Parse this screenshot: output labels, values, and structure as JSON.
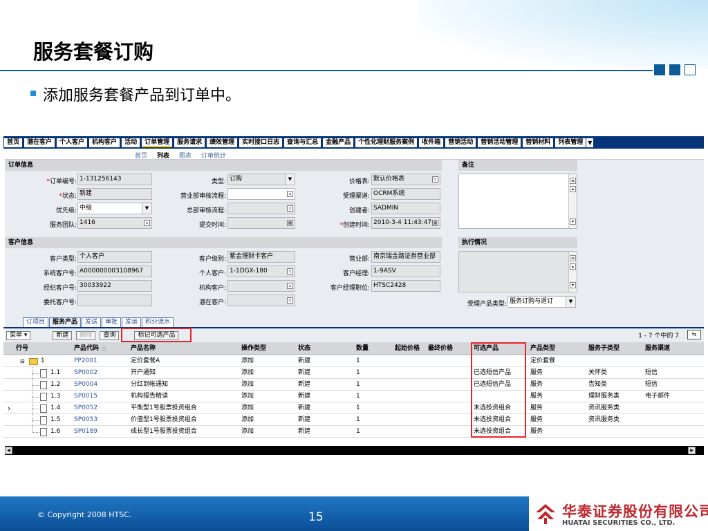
{
  "slide": {
    "title": "服务套餐订购",
    "bullet": "添加服务套餐产品到订单中。",
    "copyright": "© Copyright 2008 HTSC.",
    "page_number": "15",
    "logo_cn": "华泰证券股份有限公司",
    "logo_en": "HUATAI SECURITIES CO., LTD."
  },
  "app": {
    "tabs": [
      "首页",
      "潜在客户",
      "个人客户",
      "机构客户",
      "活动",
      "订单管理",
      "服务请求",
      "绩效管理",
      "实时接口日志",
      "查询与汇总",
      "金融产品",
      "个性化理财服务案例",
      "收件箱",
      "营销活动",
      "营销活动管理",
      "营销材料",
      "列表管理"
    ],
    "active_tab": "订单管理",
    "subnav": [
      "首页",
      "列表",
      "图表",
      "订单统计"
    ],
    "order_section": {
      "title": "订单信息",
      "fields": {
        "order_no_label": "订单编号:",
        "order_no": "1-131256143",
        "status_label": "状态:",
        "status": "新建",
        "priority_label": "优先级:",
        "priority": "中级",
        "team_label": "服务团队:",
        "team": "1416",
        "type_label": "类型:",
        "type": "订购",
        "biz_review_label": "营业部审核流程:",
        "biz_review": "",
        "hq_review_label": "总部审核流程:",
        "hq_review": "",
        "submit_time_label": "提交时间:",
        "submit_time": "",
        "price_list_label": "价格表:",
        "price_list": "默认价格表",
        "channel_label": "受理渠道:",
        "channel": "OCRM系统",
        "creator_label": "创建者:",
        "creator": "SADMIN",
        "created_label": "创建时间:",
        "created": "2010-3-4 11:43:47"
      }
    },
    "remark_section": {
      "title": "备注"
    },
    "customer_section": {
      "title": "客户信息",
      "fields": {
        "cust_type_label": "客户类型:",
        "cust_type": "个人客户",
        "sys_no_label": "系统客户号:",
        "sys_no": "A000000003108967",
        "broker_no_label": "经纪客户号:",
        "broker_no": "30033922",
        "trust_no_label": "委托客户号:",
        "trust_no": "",
        "level_label": "客户级别:",
        "level": "紫金理财卡客户",
        "personal_label": "个人客户:",
        "personal": "1-1DGX-180",
        "org_label": "机构客户:",
        "org": "",
        "potential_label": "潜在客户:",
        "potential": "",
        "branch_label": "营业部:",
        "branch": "南京瑞金路证券营业部",
        "manager_label": "客户经理:",
        "manager": "1-9ASV",
        "manager_pos_label": "客户经理职位:",
        "manager_pos": "HTSC2428"
      }
    },
    "exec_section": {
      "title": "执行情况",
      "product_type_label": "受理产品类型:",
      "product_type": "服务订购与退订"
    },
    "subtabs": [
      "订项目",
      "服务产品",
      "发送",
      "审批",
      "发运",
      "积分流水"
    ],
    "active_subtab": "服务产品",
    "toolbar": {
      "menu": "菜单",
      "new": "新建",
      "delete": "删除",
      "query": "查询",
      "mark": "标记可选产品"
    },
    "pager": "1 - 7 个中的 7",
    "overflow_text": "0 o",
    "grid": {
      "columns": [
        "行号",
        "产品代码",
        "产品名称",
        "操作类型",
        "状态",
        "数量",
        "起始价格",
        "最终价格",
        "可选产品",
        "产品类型",
        "服务子类型",
        "服务渠道"
      ],
      "sort_marker": "△",
      "rows": [
        {
          "line": "1",
          "code": "PP2001",
          "name": "定价套餐A",
          "op": "添加",
          "status": "新建",
          "qty": "1",
          "optional": "",
          "ptype": "定价套餐",
          "subtype": "",
          "channel": ""
        },
        {
          "line": "1.1",
          "code": "SP0002",
          "name": "开户通知",
          "op": "添加",
          "status": "新建",
          "qty": "1",
          "optional": "已选短信产品",
          "ptype": "服务",
          "subtype": "关怀类",
          "channel": "短信"
        },
        {
          "line": "1.2",
          "code": "SP0004",
          "name": "分红到帐通知",
          "op": "添加",
          "status": "新建",
          "qty": "1",
          "optional": "已选短信产品",
          "ptype": "服务",
          "subtype": "告知类",
          "channel": "短信"
        },
        {
          "line": "1.3",
          "code": "SP0015",
          "name": "机构报告精读",
          "op": "添加",
          "status": "新建",
          "qty": "1",
          "optional": "",
          "ptype": "服务",
          "subtype": "理财服务类",
          "channel": "电子邮件"
        },
        {
          "line": "1.4",
          "code": "SP0052",
          "name": "平衡型1号股票投资组合",
          "op": "添加",
          "status": "新建",
          "qty": "1",
          "optional": "未选投资组合",
          "ptype": "服务",
          "subtype": "资讯服务类",
          "channel": ""
        },
        {
          "line": "1.5",
          "code": "SP0053",
          "name": "价值型1号股票投资组合",
          "op": "添加",
          "status": "新建",
          "qty": "1",
          "optional": "未选投资组合",
          "ptype": "服务",
          "subtype": "资讯服务类",
          "channel": ""
        },
        {
          "line": "1.6",
          "code": "SP0189",
          "name": "成长型1号股票投资组合",
          "op": "添加",
          "status": "新建",
          "qty": "1",
          "optional": "未选投资组合",
          "ptype": "服务",
          "subtype": "",
          "channel": ""
        }
      ],
      "selected_row": "1.4"
    }
  },
  "colors": {
    "nav_blue": "#06347a",
    "highlight_red": "#e8232a",
    "link_blue": "#2f55a4",
    "brand_red": "#c0282e"
  }
}
